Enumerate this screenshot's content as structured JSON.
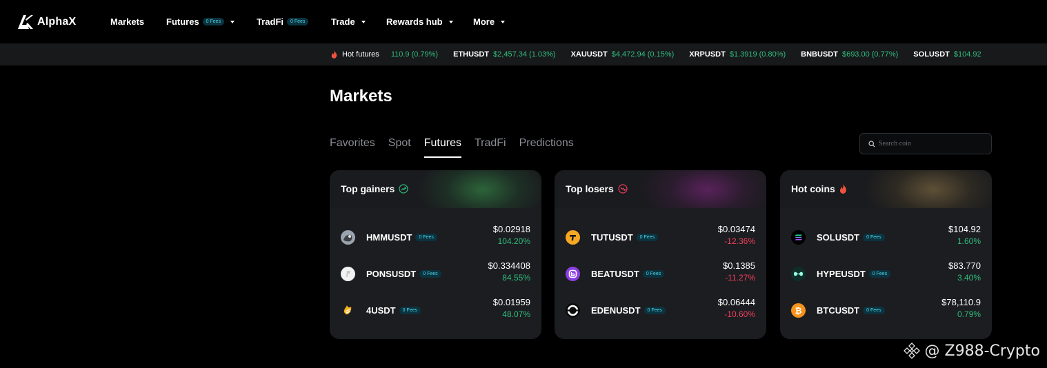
{
  "brand": {
    "name": "AlphaX"
  },
  "nav": {
    "items": [
      {
        "label": "Markets"
      },
      {
        "label": "Futures",
        "badge": "0 Fees"
      },
      {
        "label": "TradFi",
        "badge": "0 Fees"
      },
      {
        "label": "Trade"
      },
      {
        "label": "Rewards hub"
      },
      {
        "label": "More"
      }
    ]
  },
  "ticker": {
    "label": "Hot futures",
    "items": [
      {
        "symbol": "",
        "value": "110.9 (0.79%)"
      },
      {
        "symbol": "ETHUSDT",
        "value": "$2,457.34 (1.03%)"
      },
      {
        "symbol": "XAUUSDT",
        "value": "$4,472.94 (0.15%)"
      },
      {
        "symbol": "XRPUSDT",
        "value": "$1.3919 (0.80%)"
      },
      {
        "symbol": "BNBUSDT",
        "value": "$693.00 (0.77%)"
      },
      {
        "symbol": "SOLUSDT",
        "value": "$104.92"
      }
    ]
  },
  "page": {
    "title": "Markets"
  },
  "tabs": [
    "Favorites",
    "Spot",
    "Futures",
    "TradFi",
    "Predictions"
  ],
  "active_tab": "Futures",
  "search": {
    "placeholder": "Search coin"
  },
  "fee_badge": "0 Fees",
  "cards": [
    {
      "title": "Top gainers",
      "icon": "trend-up-icon",
      "rows": [
        {
          "symbol": "HMMUSDT",
          "price": "$0.02918",
          "change": "104.20%",
          "dir": "up",
          "icon": "hmm-coin-icon"
        },
        {
          "symbol": "PONSUSDT",
          "price": "$0.334408",
          "change": "84.55%",
          "dir": "up",
          "icon": "pons-coin-icon"
        },
        {
          "symbol": "4USDT",
          "price": "$0.01959",
          "change": "48.07%",
          "dir": "up",
          "icon": "four-coin-icon"
        }
      ]
    },
    {
      "title": "Top losers",
      "icon": "trend-down-icon",
      "rows": [
        {
          "symbol": "TUTUSDT",
          "price": "$0.03474",
          "change": "-12.36%",
          "dir": "down",
          "icon": "tut-coin-icon"
        },
        {
          "symbol": "BEATUSDT",
          "price": "$0.1385",
          "change": "-11.27%",
          "dir": "down",
          "icon": "beat-coin-icon"
        },
        {
          "symbol": "EDENUSDT",
          "price": "$0.06444",
          "change": "-10.60%",
          "dir": "down",
          "icon": "eden-coin-icon"
        }
      ]
    },
    {
      "title": "Hot coins",
      "icon": "flame-icon",
      "rows": [
        {
          "symbol": "SOLUSDT",
          "price": "$104.92",
          "change": "1.60%",
          "dir": "up",
          "icon": "sol-coin-icon"
        },
        {
          "symbol": "HYPEUSDT",
          "price": "$83.770",
          "change": "3.40%",
          "dir": "up",
          "icon": "hype-coin-icon"
        },
        {
          "symbol": "BTCUSDT",
          "price": "$78,110.9",
          "change": "0.79%",
          "dir": "up",
          "icon": "btc-coin-icon"
        }
      ]
    }
  ],
  "watermark": "@ Z988-Crypto",
  "colors": {
    "up": "#2fbd7d",
    "down": "#ef3f5e",
    "badge": "#4dd6e6"
  }
}
